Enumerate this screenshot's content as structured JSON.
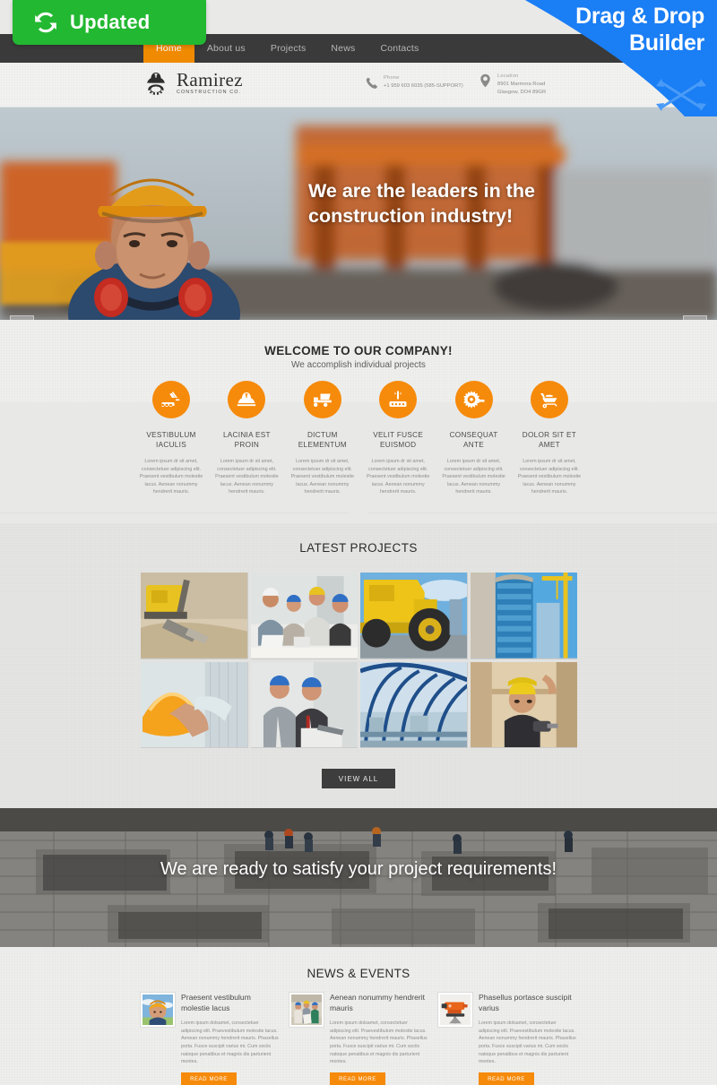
{
  "overlay": {
    "updated_badge": {
      "label": "Updated",
      "icon": "refresh-icon",
      "color": "#23b832"
    },
    "ribbon": {
      "line1": "Drag & Drop",
      "line2": "Builder",
      "icon": "move-arrows-icon",
      "color": "#1a7ef5"
    }
  },
  "nav": {
    "items": [
      {
        "label": "Home",
        "active": true
      },
      {
        "label": "About us",
        "active": false
      },
      {
        "label": "Projects",
        "active": false
      },
      {
        "label": "News",
        "active": false
      },
      {
        "label": "Contacts",
        "active": false
      }
    ]
  },
  "header": {
    "logo": {
      "name": "Ramirez",
      "tagline": "CONSTRUCTION CO.",
      "icon": "hardhat-gear-icon"
    },
    "phone": {
      "label": "Phone",
      "value": "+1 959 603 6035 (585-SUPPORT)",
      "icon": "phone-icon"
    },
    "location": {
      "label": "Location",
      "line1": "8901 Marmora Road",
      "line2": "Glasgow, DO4 89GR",
      "icon": "map-pin-icon"
    }
  },
  "hero": {
    "title": "We are the leaders in the construction industry!",
    "prev_icon": "chevron-left-icon",
    "next_icon": "chevron-right-icon"
  },
  "welcome": {
    "title": "WELCOME TO OUR COMPANY!",
    "subtitle": "We accomplish individual projects",
    "body": "Lorem ipsum dr sit amet, consectetuer adipiscing elit. Praesent vestibulum molestie lacus. Aenean nonummy hendrerit mauris.",
    "services": [
      {
        "title": "VESTIBULUM IACULIS",
        "icon": "excavator-icon"
      },
      {
        "title": "LACINIA EST PROIN",
        "icon": "hardhat-icon"
      },
      {
        "title": "DICTUM ELEMENTUM",
        "icon": "dump-truck-icon"
      },
      {
        "title": "VELIT FUSCE EUISMOD",
        "icon": "roller-icon"
      },
      {
        "title": "CONSEQUAT ANTE",
        "icon": "saw-blade-icon"
      },
      {
        "title": "DOLOR SIT ET AMET",
        "icon": "wheelbarrow-icon"
      }
    ]
  },
  "projects": {
    "title": "LATEST PROJECTS",
    "view_all_label": "VIEW ALL",
    "items": [
      {
        "alt": "yellow excavator bucket in sand"
      },
      {
        "alt": "team of engineers with laptop and hard hats"
      },
      {
        "alt": "yellow haul truck close up"
      },
      {
        "alt": "blue glass tower under construction"
      },
      {
        "alt": "hand holding orange hard hat"
      },
      {
        "alt": "two businessmen with laptop on site"
      },
      {
        "alt": "curved glass roof walkway"
      },
      {
        "alt": "carpenter with drill and yellow helmet"
      }
    ]
  },
  "cta": {
    "text": "We are ready to satisfy your project requirements!"
  },
  "news": {
    "title": "NEWS & EVENTS",
    "read_more_label": "READ MORE",
    "items": [
      {
        "heading": "Praesent vestibulum molestie lacus",
        "text": "Lorem ipsum dolsamet, consectetuer adipiscing elit. Praevestibulum molestie lacus. Aenean nonummy hendrerit mauris. Phasellus porta. Fusce suscipit varius mi. Cum sociis natoque penatibus et magnis dis parturient montes.",
        "thumb_alt": "worker in orange helmet portrait"
      },
      {
        "heading": "Aenean nonummy hendrerit mauris",
        "text": "Lorem ipsum dolsamet, consectetuer adipiscing elit. Praevestibulum molestie lacus. Aenean nonummy hendrerit mauris. Phasellus porta. Fusce suscipit varius mi. Cum sociis natoque penatibus et magnis dis parturient montes.",
        "thumb_alt": "construction crew on site"
      },
      {
        "heading": "Phasellus portasce suscipit varius",
        "text": "Lorem ipsum dolsamet, consectetuer adipiscing elit. Praevestibulum molestie lacus. Aenean nonummy hendrerit mauris. Phasellus porta. Fusce suscipit varius mi. Cum sociis natoque penatibus et magnis dis parturient montes.",
        "thumb_alt": "orange surveying level instrument"
      }
    ]
  },
  "colors": {
    "accent_orange": "#f68a0a",
    "nav_dark": "#3a3a3a",
    "badge_green": "#23b832",
    "ribbon_blue": "#1a7ef5"
  }
}
